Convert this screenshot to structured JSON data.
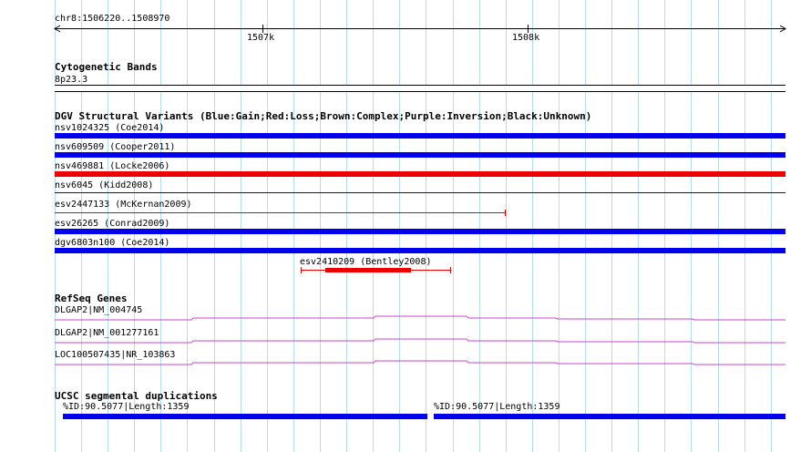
{
  "ruler": {
    "location": "chr8:1506220..1508970",
    "tick_labels": [
      "1507k",
      "1508k"
    ]
  },
  "cytobands": {
    "title": "Cytogenetic Bands",
    "band": "8p23.3"
  },
  "dgv": {
    "title": "DGV Structural Variants (Blue:Gain;Red:Loss;Brown:Complex;Purple:Inversion;Black:Unknown)",
    "colors": {
      "gain": "#0000ee",
      "loss": "#ee0000"
    },
    "features": [
      {
        "label": "nsv1024325 (Coe2014)",
        "type": "gain"
      },
      {
        "label": "nsv609509 (Cooper2011)",
        "type": "gain"
      },
      {
        "label": "nsv469881 (Locke2006)",
        "type": "loss"
      },
      {
        "label": "nsv6045 (Kidd2008)",
        "type": "gain"
      },
      {
        "label": "esv2447133 (McKernan2009)",
        "type": "loss"
      },
      {
        "label": "esv26265 (Conrad2009)",
        "type": "gain"
      },
      {
        "label": "dgv6803n100 (Coe2014)",
        "type": "gain"
      },
      {
        "label": "esv2410209 (Bentley2008)",
        "type": "loss"
      }
    ]
  },
  "refseq": {
    "title": "RefSeq Genes",
    "color": "#cc44cc",
    "genes": [
      {
        "label": "DLGAP2|NM_004745"
      },
      {
        "label": "DLGAP2|NM_001277161"
      },
      {
        "label": "LOC100507435|NR_103863"
      }
    ]
  },
  "segdups": {
    "title": "UCSC segmental duplications",
    "color": "#0000ee",
    "features": [
      {
        "label": "%ID:90.5077|Length:1359"
      },
      {
        "label": "%ID:90.5077|Length:1359"
      }
    ]
  },
  "colors": {
    "grid": "#b4dcec",
    "gain": "#0000ee",
    "loss": "#ee0000"
  }
}
